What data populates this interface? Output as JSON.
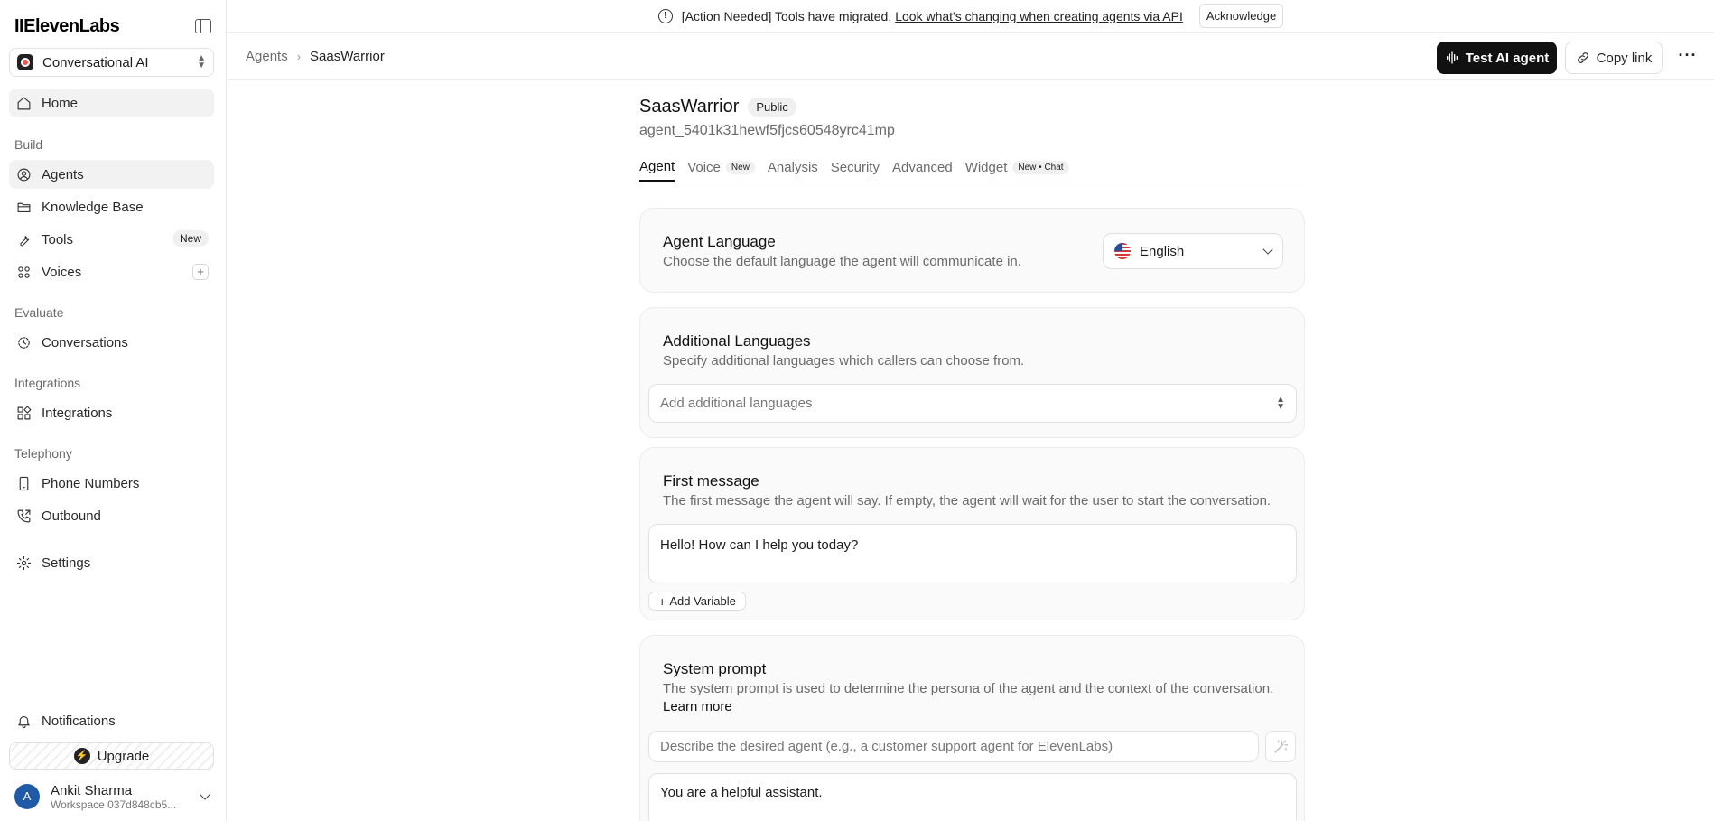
{
  "sidebar": {
    "logo": "IIElevenLabs",
    "workspace": "Conversational AI",
    "home": "Home",
    "sections": {
      "build": "Build",
      "evaluate": "Evaluate",
      "integrations": "Integrations",
      "telephony": "Telephony"
    },
    "items": {
      "agents": "Agents",
      "knowledge_base": "Knowledge Base",
      "tools": "Tools",
      "tools_badge": "New",
      "voices": "Voices",
      "conversations": "Conversations",
      "integrations": "Integrations",
      "phone_numbers": "Phone Numbers",
      "outbound": "Outbound",
      "settings": "Settings",
      "notifications": "Notifications"
    },
    "upgrade": "Upgrade",
    "user": {
      "initial": "A",
      "name": "Ankit Sharma",
      "workspace": "Workspace 037d848cb5..."
    }
  },
  "banner": {
    "text": "[Action Needed] Tools have migrated.",
    "link": "Look what's changing when creating agents via API",
    "button": "Acknowledge"
  },
  "header": {
    "breadcrumb_root": "Agents",
    "breadcrumb_current": "SaasWarrior",
    "test_button": "Test AI agent",
    "copy_button": "Copy link"
  },
  "agent": {
    "name": "SaasWarrior",
    "visibility": "Public",
    "id": "agent_5401k31hewf5fjcs60548yrc41mp"
  },
  "tabs": [
    {
      "label": "Agent",
      "badge": ""
    },
    {
      "label": "Voice",
      "badge": "New"
    },
    {
      "label": "Analysis",
      "badge": ""
    },
    {
      "label": "Security",
      "badge": ""
    },
    {
      "label": "Advanced",
      "badge": ""
    },
    {
      "label": "Widget",
      "badge": "New • Chat"
    }
  ],
  "agent_language": {
    "title": "Agent Language",
    "description": "Choose the default language the agent will communicate in.",
    "value": "English"
  },
  "additional_languages": {
    "title": "Additional Languages",
    "description": "Specify additional languages which callers can choose from.",
    "placeholder": "Add additional languages"
  },
  "first_message": {
    "title": "First message",
    "description": "The first message the agent will say. If empty, the agent will wait for the user to start the conversation.",
    "value": "Hello! How can I help you today?",
    "add_variable": "Add Variable"
  },
  "system_prompt": {
    "title": "System prompt",
    "description": "The system prompt is used to determine the persona of the agent and the context of the conversation.",
    "learn_more": "Learn more",
    "generate_placeholder": "Describe the desired agent (e.g., a customer support agent for ElevenLabs)",
    "value": "You are a helpful assistant."
  },
  "colors": {
    "accent": "#111111",
    "card_bg": "#fafafa",
    "muted_text": "#6b6b6b",
    "avatar": "#1f5aa8"
  }
}
